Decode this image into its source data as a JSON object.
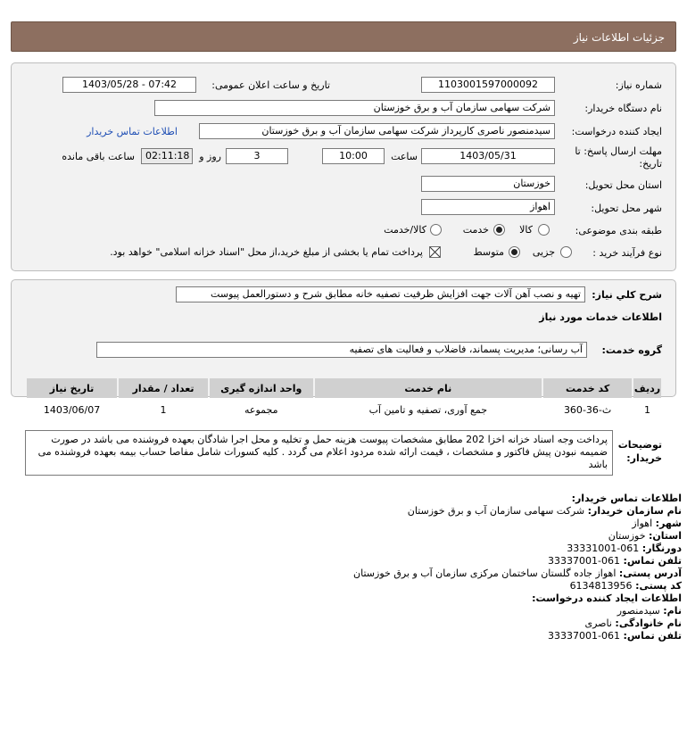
{
  "header": {
    "title": "جزئیات اطلاعات نیاز"
  },
  "form": {
    "need_number_label": "شماره نیاز:",
    "need_number": "1103001597000092",
    "announce_label": "تاریخ و ساعت اعلان عمومی:",
    "announce_value": "1403/05/28 - 07:42",
    "buyer_org_label": "نام دستگاه خریدار:",
    "buyer_org": "شرکت سهامی سازمان آب و برق خوزستان",
    "requester_label": "ایجاد کننده درخواست:",
    "requester": "سیدمنصور ناصری کارپرداز شرکت سهامی سازمان آب و برق خوزستان",
    "buyer_contact_link": "اطلاعات تماس خریدار",
    "deadline_label_1": "مهلت ارسال پاسخ: تا",
    "deadline_label_2": "تاریخ:",
    "deadline_date": "1403/05/31",
    "time_label": "ساعت",
    "deadline_time": "10:00",
    "days_value": "3",
    "days_label": "روز و",
    "remaining_time": "02:11:18",
    "remaining_label": "ساعت باقی مانده",
    "province_label": "استان محل تحویل:",
    "province": "خوزستان",
    "city_label": "شهر محل تحویل:",
    "city": "اهواز",
    "category_label": "طبقه بندی موضوعی:",
    "category_options": [
      "کالا",
      "خدمت",
      "کالا/خدمت"
    ],
    "category_selected": "خدمت",
    "process_label": "نوع فرآیند خرید :",
    "process_options": [
      "جزیی",
      "متوسط"
    ],
    "process_selected": "متوسط",
    "treasury_note": "پرداخت تمام یا بخشی از مبلغ خرید،از محل \"اسناد خزانه اسلامی\" خواهد بود."
  },
  "description": {
    "label": "شرح کلي نياز:",
    "text": "تهیه و نصب آهن آلات جهت افزایش ظرفیت تصفیه خانه مطابق شرح و دستورالعمل پیوست"
  },
  "services": {
    "section_title": "اطلاعات خدمات مورد نیاز",
    "group_label": "گروه خدمت:",
    "group_value": "آب رسانی؛ مدیریت پسماند، فاضلاب و فعالیت های تصفیه",
    "columns": [
      "ردیف",
      "کد خدمت",
      "نام خدمت",
      "واحد اندازه گیری",
      "تعداد / مقدار",
      "تاریخ نیاز"
    ],
    "rows": [
      {
        "row": "1",
        "code": "ث-36-360",
        "name": "جمع آوری، تصفیه و تامین آب",
        "unit": "مجموعه",
        "qty": "1",
        "date": "1403/06/07"
      }
    ]
  },
  "buyer_notes": {
    "label_1": "توضیحات",
    "label_2": "خریدار:",
    "text": "پرداخت وجه اسناد خزانه اخزا 202 مطابق مشخصات پیوست هزینه حمل و تخلیه و محل اجرا شادگان بعهده فروشنده می باشد در صورت ضمیمه نبودن پیش فاکتور و مشخصات ، قیمت ارائه شده مردود اعلام می گردد . کلیه کسورات شامل مفاصا حساب بیمه بعهده فروشنده می باشد"
  },
  "contact": {
    "title": "اطلاعات تماس خریدار:",
    "org_label": "نام سازمان خریدار:",
    "org": "شرکت سهامی سازمان آب و برق خوزستان",
    "city_label": "شهر:",
    "city": "اهواز",
    "province_label": "استان:",
    "province": "خوزستان",
    "fax_label": "دورنگار:",
    "fax": "061-33331001",
    "phone_label": "تلفن تماس:",
    "phone": "061-33337001",
    "address_label": "آدرس پستی:",
    "address": "اهواز جاده گلستان ساختمان مرکزی سازمان آب و برق خوزستان",
    "postal_label": "کد پستی:",
    "postal": "6134813956",
    "creator_title": "اطلاعات ایجاد کننده درخواست:",
    "first_name_label": "نام:",
    "first_name": "سیدمنصور",
    "last_name_label": "نام خانوادگی:",
    "last_name": "ناصری",
    "creator_phone_label": "تلفن تماس:",
    "creator_phone": "061-33337001"
  }
}
